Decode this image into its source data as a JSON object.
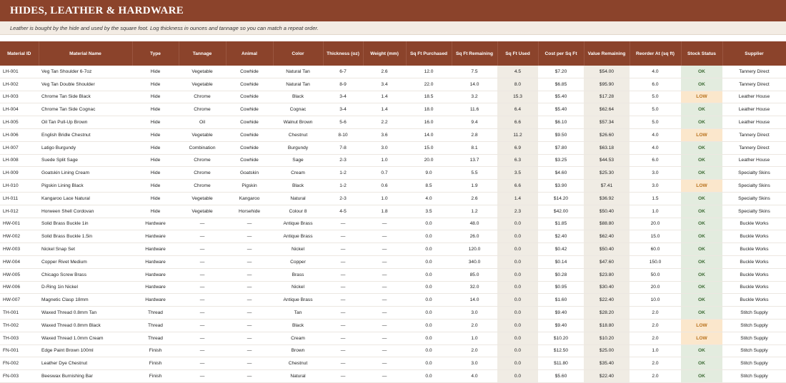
{
  "title": "HIDES, LEATHER & HARDWARE",
  "subtitle": "Leather is bought by the hide and used by the square foot. Log thickness in ounces and tannage so you can match a repeat order.",
  "columns": [
    "Material ID",
    "Material Name",
    "Type",
    "Tannage",
    "Animal",
    "Color",
    "Thickness (oz)",
    "Weight (mm)",
    "Sq Ft Purchased",
    "Sq Ft Remaining",
    "Sq Ft Used",
    "Cost per Sq Ft",
    "Value Remaining",
    "Reorder At (sq ft)",
    "Stock Status",
    "Supplier"
  ],
  "colors": {
    "header": "#8b432b",
    "ok_bg": "#e3ecdf",
    "ok_text": "#3d6b35",
    "low_bg": "#fbe7cc",
    "low_text": "#b8701a"
  },
  "rows": [
    [
      "LH-001",
      "Veg Tan Shoulder 6-7oz",
      "Hide",
      "Vegetable",
      "Cowhide",
      "Natural Tan",
      "6-7",
      "2.6",
      "12.0",
      "7.5",
      "4.5",
      "$7.20",
      "$54.00",
      "4.0",
      "OK",
      "Tannery Direct"
    ],
    [
      "LH-002",
      "Veg Tan Double Shoulder",
      "Hide",
      "Vegetable",
      "Cowhide",
      "Natural Tan",
      "8-9",
      "3.4",
      "22.0",
      "14.0",
      "8.0",
      "$6.85",
      "$95.90",
      "6.0",
      "OK",
      "Tannery Direct"
    ],
    [
      "LH-003",
      "Chrome Tan Side Black",
      "Hide",
      "Chrome",
      "Cowhide",
      "Black",
      "3-4",
      "1.4",
      "18.5",
      "3.2",
      "15.3",
      "$5.40",
      "$17.28",
      "5.0",
      "LOW",
      "Leather House"
    ],
    [
      "LH-004",
      "Chrome Tan Side Cognac",
      "Hide",
      "Chrome",
      "Cowhide",
      "Cognac",
      "3-4",
      "1.4",
      "18.0",
      "11.6",
      "6.4",
      "$5.40",
      "$62.64",
      "5.0",
      "OK",
      "Leather House"
    ],
    [
      "LH-005",
      "Oil Tan Pull-Up Brown",
      "Hide",
      "Oil",
      "Cowhide",
      "Walnut Brown",
      "5-6",
      "2.2",
      "16.0",
      "9.4",
      "6.6",
      "$6.10",
      "$57.34",
      "5.0",
      "OK",
      "Leather House"
    ],
    [
      "LH-006",
      "English Bridle Chestnut",
      "Hide",
      "Vegetable",
      "Cowhide",
      "Chestnut",
      "8-10",
      "3.6",
      "14.0",
      "2.8",
      "11.2",
      "$9.50",
      "$26.60",
      "4.0",
      "LOW",
      "Tannery Direct"
    ],
    [
      "LH-007",
      "Latigo Burgundy",
      "Hide",
      "Combination",
      "Cowhide",
      "Burgundy",
      "7-8",
      "3.0",
      "15.0",
      "8.1",
      "6.9",
      "$7.80",
      "$63.18",
      "4.0",
      "OK",
      "Tannery Direct"
    ],
    [
      "LH-008",
      "Suede Split Sage",
      "Hide",
      "Chrome",
      "Cowhide",
      "Sage",
      "2-3",
      "1.0",
      "20.0",
      "13.7",
      "6.3",
      "$3.25",
      "$44.53",
      "6.0",
      "OK",
      "Leather House"
    ],
    [
      "LH-009",
      "Goatskin Lining Cream",
      "Hide",
      "Chrome",
      "Goatskin",
      "Cream",
      "1-2",
      "0.7",
      "9.0",
      "5.5",
      "3.5",
      "$4.60",
      "$25.30",
      "3.0",
      "OK",
      "Specialty Skins"
    ],
    [
      "LH-010",
      "Pigskin Lining Black",
      "Hide",
      "Chrome",
      "Pigskin",
      "Black",
      "1-2",
      "0.6",
      "8.5",
      "1.9",
      "6.6",
      "$3.90",
      "$7.41",
      "3.0",
      "LOW",
      "Specialty Skins"
    ],
    [
      "LH-011",
      "Kangaroo Lace Natural",
      "Hide",
      "Vegetable",
      "Kangaroo",
      "Natural",
      "2-3",
      "1.0",
      "4.0",
      "2.6",
      "1.4",
      "$14.20",
      "$36.92",
      "1.5",
      "OK",
      "Specialty Skins"
    ],
    [
      "LH-012",
      "Horween Shell Cordovan",
      "Hide",
      "Vegetable",
      "Horsehide",
      "Colour 8",
      "4-5",
      "1.8",
      "3.5",
      "1.2",
      "2.3",
      "$42.00",
      "$50.40",
      "1.0",
      "OK",
      "Specialty Skins"
    ],
    [
      "HW-001",
      "Solid Brass Buckle 1in",
      "Hardware",
      "—",
      "—",
      "Antique Brass",
      "—",
      "—",
      "0.0",
      "48.0",
      "0.0",
      "$1.85",
      "$88.80",
      "20.0",
      "OK",
      "Buckle Works"
    ],
    [
      "HW-002",
      "Solid Brass Buckle 1.5in",
      "Hardware",
      "—",
      "—",
      "Antique Brass",
      "—",
      "—",
      "0.0",
      "26.0",
      "0.0",
      "$2.40",
      "$62.40",
      "15.0",
      "OK",
      "Buckle Works"
    ],
    [
      "HW-003",
      "Nickel Snap Set",
      "Hardware",
      "—",
      "—",
      "Nickel",
      "—",
      "—",
      "0.0",
      "120.0",
      "0.0",
      "$0.42",
      "$50.40",
      "60.0",
      "OK",
      "Buckle Works"
    ],
    [
      "HW-004",
      "Copper Rivet Medium",
      "Hardware",
      "—",
      "—",
      "Copper",
      "—",
      "—",
      "0.0",
      "340.0",
      "0.0",
      "$0.14",
      "$47.60",
      "150.0",
      "OK",
      "Buckle Works"
    ],
    [
      "HW-005",
      "Chicago Screw Brass",
      "Hardware",
      "—",
      "—",
      "Brass",
      "—",
      "—",
      "0.0",
      "85.0",
      "0.0",
      "$0.28",
      "$23.80",
      "50.0",
      "OK",
      "Buckle Works"
    ],
    [
      "HW-006",
      "D-Ring 1in Nickel",
      "Hardware",
      "—",
      "—",
      "Nickel",
      "—",
      "—",
      "0.0",
      "32.0",
      "0.0",
      "$0.95",
      "$30.40",
      "20.0",
      "OK",
      "Buckle Works"
    ],
    [
      "HW-007",
      "Magnetic Clasp 18mm",
      "Hardware",
      "—",
      "—",
      "Antique Brass",
      "—",
      "—",
      "0.0",
      "14.0",
      "0.0",
      "$1.60",
      "$22.40",
      "10.0",
      "OK",
      "Buckle Works"
    ],
    [
      "TH-001",
      "Waxed Thread 0.8mm Tan",
      "Thread",
      "—",
      "—",
      "Tan",
      "—",
      "—",
      "0.0",
      "3.0",
      "0.0",
      "$9.40",
      "$28.20",
      "2.0",
      "OK",
      "Stitch Supply"
    ],
    [
      "TH-002",
      "Waxed Thread 0.8mm Black",
      "Thread",
      "—",
      "—",
      "Black",
      "—",
      "—",
      "0.0",
      "2.0",
      "0.0",
      "$9.40",
      "$18.80",
      "2.0",
      "LOW",
      "Stitch Supply"
    ],
    [
      "TH-003",
      "Waxed Thread 1.0mm Cream",
      "Thread",
      "—",
      "—",
      "Cream",
      "—",
      "—",
      "0.0",
      "1.0",
      "0.0",
      "$10.20",
      "$10.20",
      "2.0",
      "LOW",
      "Stitch Supply"
    ],
    [
      "FN-001",
      "Edge Paint Brown 100ml",
      "Finish",
      "—",
      "—",
      "Brown",
      "—",
      "—",
      "0.0",
      "2.0",
      "0.0",
      "$12.50",
      "$25.00",
      "1.0",
      "OK",
      "Stitch Supply"
    ],
    [
      "FN-002",
      "Leather Dye Chestnut",
      "Finish",
      "—",
      "—",
      "Chestnut",
      "—",
      "—",
      "0.0",
      "3.0",
      "0.0",
      "$11.80",
      "$35.40",
      "2.0",
      "OK",
      "Stitch Supply"
    ],
    [
      "FN-003",
      "Beeswax Burnishing Bar",
      "Finish",
      "—",
      "—",
      "Natural",
      "—",
      "—",
      "0.0",
      "4.0",
      "0.0",
      "$5.60",
      "$22.40",
      "2.0",
      "OK",
      "Stitch Supply"
    ]
  ]
}
